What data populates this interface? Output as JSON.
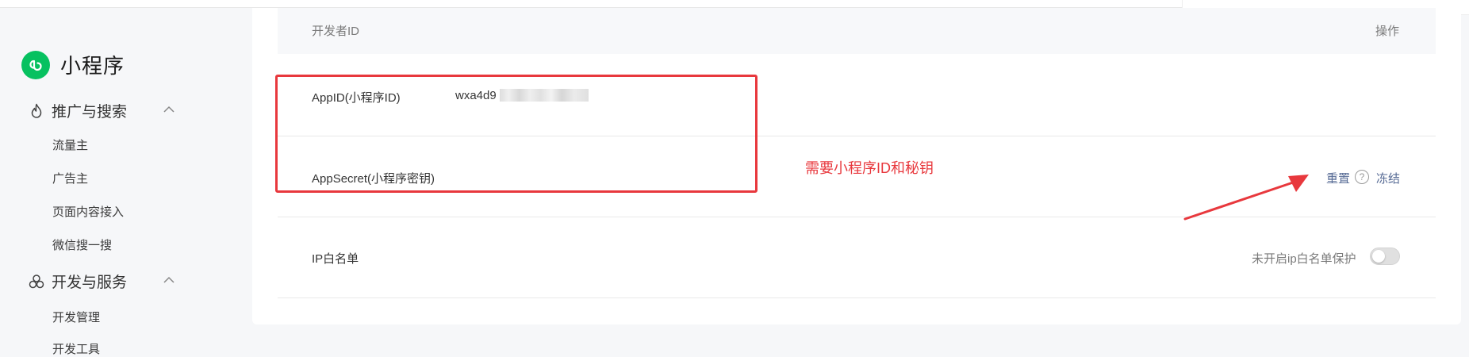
{
  "sidebar": {
    "brand": "小程序",
    "sections": [
      {
        "label": "推广与搜索",
        "items": [
          "流量主",
          "广告主",
          "页面内容接入",
          "微信搜一搜"
        ]
      },
      {
        "label": "开发与服务",
        "items": [
          "开发管理",
          "开发工具"
        ]
      }
    ]
  },
  "table": {
    "col_left": "开发者ID",
    "col_right": "操作",
    "appid_label": "AppID(小程序ID)",
    "appid_value": "wxa4d9",
    "secret_label": "AppSecret(小程序密钥)",
    "reset_link": "重置",
    "help_glyph": "?",
    "freeze_link": "冻结",
    "ip_label": "IP白名单",
    "ip_toggle_label": "未开启ip白名单保护",
    "ip_toggle_on": false
  },
  "annotation": {
    "note": "需要小程序ID和秘钥",
    "color": "#e8383d"
  },
  "colors": {
    "brand_green": "#07c160",
    "link": "#576b95"
  }
}
